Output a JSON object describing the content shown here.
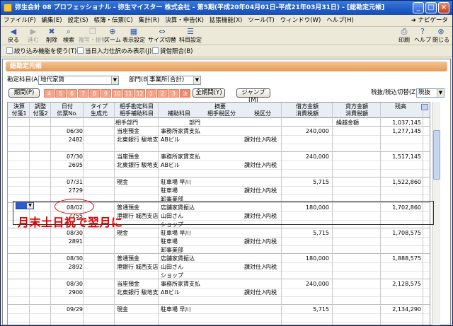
{
  "window": {
    "title": "弥生会計 08 プロフェッショナル - 弥生マイスター 株式会社 - 第5期(平成20年04月01日-平成21年03月31日) - [総勘定元帳]"
  },
  "menu": {
    "items": [
      "ファイル(F)",
      "編集(E)",
      "設定(S)",
      "帳簿・伝票(C)",
      "集計(R)",
      "決算・申告(K)",
      "拡張機能(X)",
      "ツール(T)",
      "ウィンドウ(W)",
      "ヘルプ(H)"
    ],
    "navi": "ナビゲータ"
  },
  "toolbar": {
    "left": [
      "戻る",
      "進む",
      "削除",
      "検索",
      "複写・振替",
      "ズーム",
      "表示設定",
      "サイズ切替",
      "科目設定"
    ],
    "right": [
      "印刷",
      "ヘルプ",
      "閉じる"
    ]
  },
  "options": {
    "narrow": "絞り込み機能を使う(T)",
    "today_only": "当日入力仕訳のみ表示(J)",
    "balance_check": "貸借照合(B)"
  },
  "ledger": {
    "header": "総勘定元帳",
    "account_label": "勘定科目(A)",
    "account_value": "地代家賃",
    "dept_label": "部門(B)",
    "dept_value": "事業所(合計)",
    "period_label": "期間(P)",
    "months": [
      "4",
      "5",
      "6",
      "7",
      "8",
      "9",
      "10",
      "11",
      "12",
      "1",
      "2",
      "3",
      "決"
    ],
    "all_period": "全期間(Y)",
    "jump": "ジャンプ(M)",
    "tax_label": "税抜/税込切替(Z)",
    "tax_value": "税抜"
  },
  "columns": {
    "c1a": "決算",
    "c1b": "付箋1",
    "c2a": "調整",
    "c2b": "付箋2",
    "c3a": "日付",
    "c3b": "伝票No.",
    "c4a": "タイプ",
    "c4b": "生成元",
    "c5a": "相手勘定科目",
    "c5b": "相手補助科目",
    "c5c": "相手部門",
    "c6a": "摘要",
    "c6b": "補助科目",
    "c6c": "部門",
    "c6d": "相手税区分",
    "c6e": "税区分",
    "c7a": "借方金額",
    "c7b": "消費税額",
    "c8a": "貸方金額",
    "c8b": "消費税額",
    "c9a": "残高",
    "c9b": "繰越金額"
  },
  "carryover": "1,037,145",
  "rows": [
    {
      "date": "06/30",
      "no": "2482",
      "acct": "当座預金",
      "sub": "北東銀行 駿地支",
      "dept": "",
      "memo": "事務所家賃支払",
      "memo_sub": "ABビル",
      "memo_dept": "",
      "tax": "課対仕入",
      "tax2": "内税",
      "debit": "240,000",
      "bal": "1,277,145"
    },
    {
      "date": "07/30",
      "no": "2695",
      "acct": "当座預金",
      "sub": "北東銀行 駿地支",
      "dept": "",
      "memo": "事務所家賃支払",
      "memo_sub": "ABビル",
      "memo_dept": "",
      "tax": "課対仕入",
      "tax2": "内税",
      "debit": "240,000",
      "bal": "1,517,145"
    },
    {
      "date": "07/31",
      "no": "2729",
      "acct": "現金",
      "sub": "",
      "dept": "",
      "memo": "駐車場 早川",
      "memo_sub": "駐車場",
      "memo_dept": "卸事業部",
      "tax": "課対仕入",
      "tax2": "内税",
      "debit": "5,715",
      "bal": "1,522,860"
    },
    {
      "date": "08/02",
      "no": "2755",
      "acct": "普通預金",
      "sub": "港銀行 城西支店",
      "dept": "",
      "memo": "店舗家賃振込",
      "memo_sub": "山田さん",
      "memo_dept": "ショップ",
      "tax": "課対仕入",
      "tax2": "内税",
      "debit": "180,000",
      "bal": "1,702,860"
    },
    {
      "date": "08/30",
      "no": "2891",
      "acct": "現金",
      "sub": "",
      "dept": "",
      "memo": "駐車場 早川",
      "memo_sub": "駐車場",
      "memo_dept": "卸事業部",
      "tax": "課対仕入",
      "tax2": "内税",
      "debit": "5,715",
      "bal": "1,708,575"
    },
    {
      "date": "08/30",
      "no": "2892",
      "acct": "普通預金",
      "sub": "港銀行 城西支店",
      "dept": "",
      "memo": "店舗家賃振込",
      "memo_sub": "山田さん",
      "memo_dept": "ショップ",
      "tax": "課対仕入",
      "tax2": "内税",
      "debit": "180,000",
      "bal": "1,888,575"
    },
    {
      "date": "08/30",
      "no": "2900",
      "acct": "当座預金",
      "sub": "北東銀行 駿地支",
      "dept": "",
      "memo": "事務所家賃支払",
      "memo_sub": "ABビル",
      "memo_dept": "",
      "tax": "課対仕入",
      "tax2": "内税",
      "debit": "240,000",
      "bal": "2,128,575"
    },
    {
      "date": "09/29",
      "no": "",
      "acct": "現金",
      "sub": "",
      "dept": "",
      "memo": "駐車場 早川",
      "memo_sub": "",
      "memo_dept": "",
      "tax": "",
      "tax2": "",
      "debit": "5,715",
      "bal": "2,134,290"
    }
  ],
  "annotation": "月末土日祝で翌月に",
  "colors": {
    "accent": "#e59a56",
    "annotation": "#e00000"
  }
}
